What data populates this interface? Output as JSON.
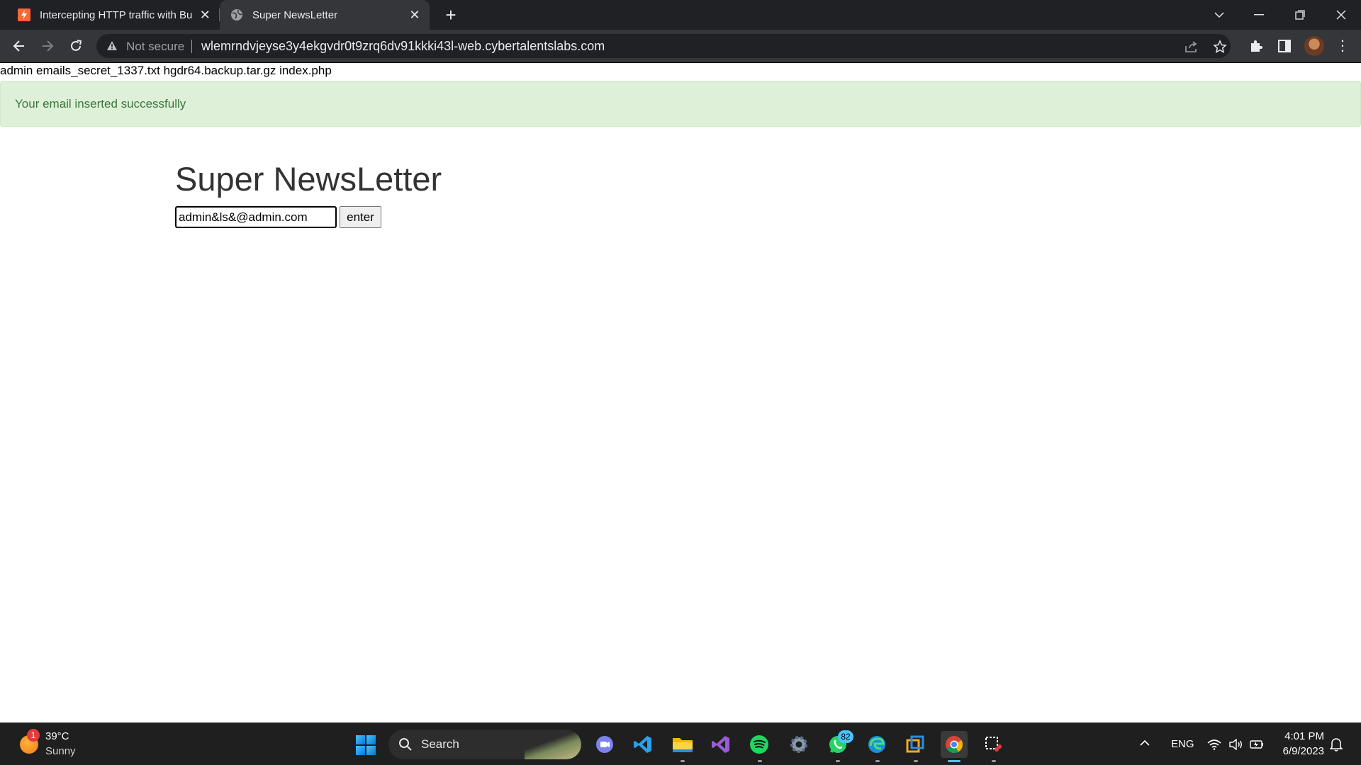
{
  "browser": {
    "tabs": [
      {
        "title": "Intercepting HTTP traffic with Bur",
        "active": false
      },
      {
        "title": "Super NewsLetter",
        "active": true
      }
    ],
    "security_label": "Not secure",
    "url": "wlemrndvjeyse3y4ekgvdr0t9zrq6dv91kkki43l-web.cybertalentslabs.com"
  },
  "page": {
    "listing": "admin emails_secret_1337.txt hgdr64.backup.tar.gz index.php",
    "alert": "Your email inserted successfully",
    "heading": "Super NewsLetter",
    "email_value": "admin&ls&@admin.com",
    "submit_label": "enter"
  },
  "taskbar": {
    "weather_badge": "1",
    "weather_temp": "39°C",
    "weather_condition": "Sunny",
    "search_label": "Search",
    "whatsapp_badge": "82",
    "language": "ENG",
    "time": "4:01 PM",
    "date": "6/9/2023"
  },
  "colors": {
    "alert_bg": "#dff0d8",
    "alert_text": "#3c763d",
    "tabbar_bg": "#202124",
    "toolbar_bg": "#35363a"
  }
}
